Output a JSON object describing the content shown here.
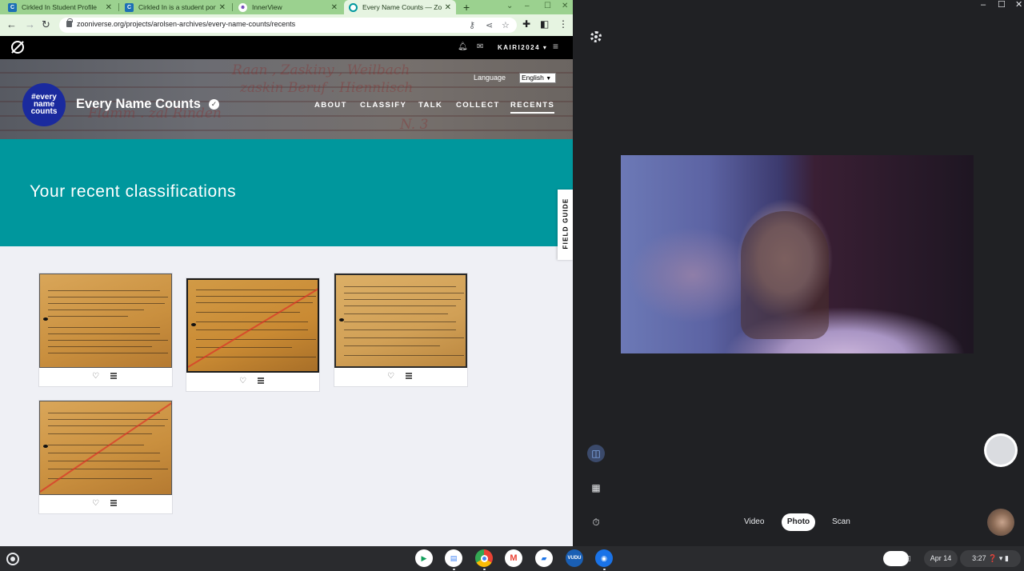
{
  "browser": {
    "tabs": [
      {
        "title": "Cirkled In Student Profile",
        "icon": "cirkled-in-icon"
      },
      {
        "title": "Cirkled In is a student portf",
        "icon": "cirkled-in-icon"
      },
      {
        "title": "InnerView",
        "icon": "innerview-icon"
      },
      {
        "title": "Every Name Counts — Zoon",
        "icon": "zooniverse-icon",
        "active": true
      }
    ],
    "url": "zooniverse.org/projects/arolsen-archives/every-name-counts/recents"
  },
  "site": {
    "username": "KAIRI2024",
    "project_title": "Every Name Counts",
    "badge_text": [
      "#every",
      "name",
      "counts"
    ],
    "language_label": "Language",
    "language_value": "English",
    "nav": [
      "ABOUT",
      "CLASSIFY",
      "TALK",
      "COLLECT",
      "RECENTS"
    ],
    "active_nav": "RECENTS",
    "heading": "Your recent classifications",
    "field_guide": "FIELD GUIDE",
    "recents_count": 4
  },
  "camera": {
    "modes": [
      "Video",
      "Photo",
      "Scan"
    ],
    "selected_mode": "Photo"
  },
  "shelf": {
    "date": "Apr 14",
    "time": "3:27",
    "apps": [
      "play-store",
      "docs",
      "chrome",
      "gmail",
      "files",
      "vudu",
      "camera"
    ]
  },
  "colors": {
    "tab_strip": "#9bd18f",
    "banner": "#00979d",
    "badge": "#1a2a9e"
  }
}
